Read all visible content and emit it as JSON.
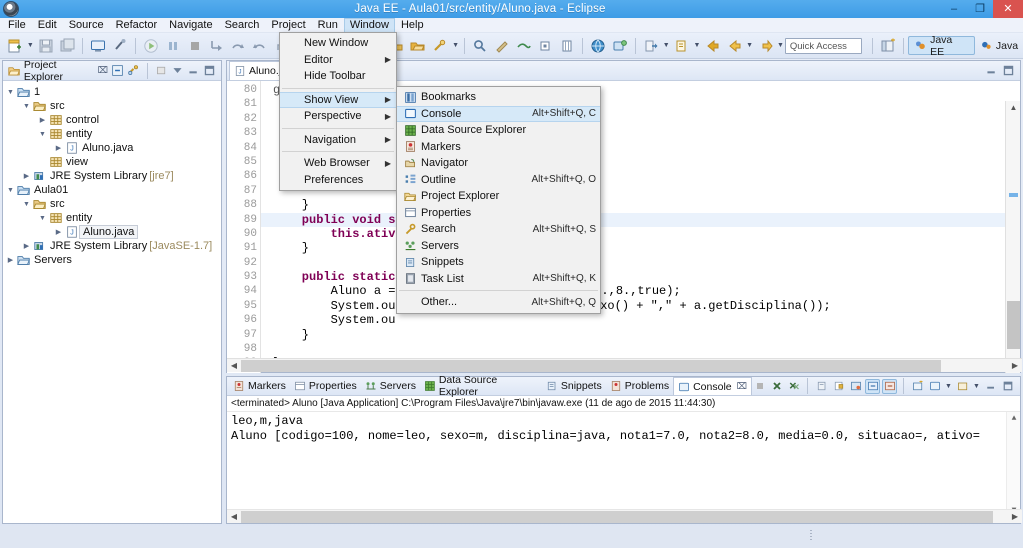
{
  "window": {
    "title": "Java EE - Aula01/src/entity/Aluno.java - Eclipse",
    "minimize_label": "–",
    "restore_label": "❐",
    "close_label": "✕"
  },
  "menubar": {
    "items": [
      {
        "label": "File",
        "active": false
      },
      {
        "label": "Edit",
        "active": false
      },
      {
        "label": "Source",
        "active": false
      },
      {
        "label": "Refactor",
        "active": false
      },
      {
        "label": "Navigate",
        "active": false
      },
      {
        "label": "Search",
        "active": false
      },
      {
        "label": "Project",
        "active": false
      },
      {
        "label": "Run",
        "active": false
      },
      {
        "label": "Window",
        "active": true
      },
      {
        "label": "Help",
        "active": false
      }
    ]
  },
  "toolbar": {
    "quick_access_placeholder": "Quick Access",
    "perspectives": [
      {
        "label": "Java EE",
        "selected": true
      },
      {
        "label": "Java",
        "selected": false
      }
    ]
  },
  "window_menu": {
    "items": [
      {
        "label": "New Window",
        "submenu": false,
        "highlighted": false
      },
      {
        "label": "Editor",
        "submenu": true,
        "highlighted": false
      },
      {
        "label": "Hide Toolbar",
        "submenu": false,
        "highlighted": false
      },
      {
        "separator": true
      },
      {
        "label": "Show View",
        "submenu": true,
        "highlighted": true
      },
      {
        "label": "Perspective",
        "submenu": true,
        "highlighted": false
      },
      {
        "separator": true
      },
      {
        "label": "Navigation",
        "submenu": true,
        "highlighted": false
      },
      {
        "separator": true
      },
      {
        "label": "Web Browser",
        "submenu": true,
        "highlighted": false
      },
      {
        "label": "Preferences",
        "submenu": false,
        "highlighted": false
      }
    ]
  },
  "show_view_menu": {
    "items": [
      {
        "label": "Bookmarks",
        "accel": "",
        "icon": "bookmarks-icon",
        "highlighted": false
      },
      {
        "label": "Console",
        "accel": "Alt+Shift+Q, C",
        "icon": "console-icon",
        "highlighted": true
      },
      {
        "label": "Data Source Explorer",
        "accel": "",
        "icon": "data-source-explorer-icon",
        "highlighted": false
      },
      {
        "label": "Markers",
        "accel": "",
        "icon": "markers-icon",
        "highlighted": false
      },
      {
        "label": "Navigator",
        "accel": "",
        "icon": "navigator-icon",
        "highlighted": false
      },
      {
        "label": "Outline",
        "accel": "Alt+Shift+Q, O",
        "icon": "outline-icon",
        "highlighted": false
      },
      {
        "label": "Project Explorer",
        "accel": "",
        "icon": "project-explorer-icon",
        "highlighted": false
      },
      {
        "label": "Properties",
        "accel": "",
        "icon": "properties-icon",
        "highlighted": false
      },
      {
        "label": "Search",
        "accel": "Alt+Shift+Q, S",
        "icon": "search-icon",
        "highlighted": false
      },
      {
        "label": "Servers",
        "accel": "",
        "icon": "servers-icon",
        "highlighted": false
      },
      {
        "label": "Snippets",
        "accel": "",
        "icon": "snippets-icon",
        "highlighted": false
      },
      {
        "label": "Task List",
        "accel": "Alt+Shift+Q, K",
        "icon": "task-list-icon",
        "highlighted": false
      },
      {
        "separator": true
      },
      {
        "label": "Other...",
        "accel": "Alt+Shift+Q, Q",
        "icon": "",
        "highlighted": false
      }
    ]
  },
  "explorer": {
    "tab_label": "Project Explorer",
    "close_glyph": "⌧",
    "tree": [
      {
        "depth": 0,
        "twist": "open",
        "icon": "project-icon",
        "label": "1",
        "dim": "",
        "selected": false
      },
      {
        "depth": 1,
        "twist": "open",
        "icon": "folder-icon",
        "label": "src",
        "dim": "",
        "selected": false
      },
      {
        "depth": 2,
        "twist": "closed",
        "icon": "package-icon",
        "label": "control",
        "dim": "",
        "selected": false
      },
      {
        "depth": 2,
        "twist": "open",
        "icon": "package-icon",
        "label": "entity",
        "dim": "",
        "selected": false
      },
      {
        "depth": 3,
        "twist": "closed",
        "icon": "java-file-icon",
        "label": "Aluno.java",
        "dim": "",
        "selected": false
      },
      {
        "depth": 2,
        "twist": "none",
        "icon": "package-icon",
        "label": "view",
        "dim": "",
        "selected": false
      },
      {
        "depth": 1,
        "twist": "closed",
        "icon": "library-icon",
        "label": "JRE System Library",
        "dim": "[jre7]",
        "selected": false
      },
      {
        "depth": 0,
        "twist": "open",
        "icon": "project-icon",
        "label": "Aula01",
        "dim": "",
        "selected": false
      },
      {
        "depth": 1,
        "twist": "open",
        "icon": "folder-icon",
        "label": "src",
        "dim": "",
        "selected": false
      },
      {
        "depth": 2,
        "twist": "open",
        "icon": "package-icon",
        "label": "entity",
        "dim": "",
        "selected": false
      },
      {
        "depth": 3,
        "twist": "closed",
        "icon": "java-file-icon",
        "label": "Aluno.java",
        "dim": "",
        "selected": true
      },
      {
        "depth": 1,
        "twist": "closed",
        "icon": "library-icon",
        "label": "JRE System Library",
        "dim": "[JavaSE-1.7]",
        "selected": false
      },
      {
        "depth": 0,
        "twist": "closed",
        "icon": "folder-icon",
        "label": "Servers",
        "dim": "",
        "selected": false
      }
    ]
  },
  "editor": {
    "tab_label": "Aluno.jav",
    "first_line": 80,
    "highlight_line": 89,
    "lines": [
      {
        "n": 80,
        "fold": true,
        "text": "",
        "highlighted": false
      },
      {
        "n": 81,
        "fold": false,
        "text": "",
        "highlighted": false
      },
      {
        "n": 82,
        "fold": false,
        "text": "",
        "highlighted": false
      },
      {
        "n": 83,
        "fold": true,
        "text": "",
        "highlighted": false
      },
      {
        "n": 84,
        "fold": false,
        "text": "",
        "highlighted": false
      },
      {
        "n": 85,
        "fold": false,
        "text": "",
        "highlighted": false
      },
      {
        "n": 86,
        "fold": true,
        "text": "",
        "highlighted": false
      },
      {
        "n": 87,
        "fold": false,
        "text": "",
        "highlighted": false
      },
      {
        "n": 88,
        "fold": false,
        "text": "    }",
        "highlighted": false
      },
      {
        "n": 89,
        "fold": true,
        "text": "    public void s",
        "highlighted": true
      },
      {
        "n": 90,
        "fold": false,
        "text": "        this.ativ",
        "highlighted": false
      },
      {
        "n": 91,
        "fold": false,
        "text": "    }",
        "highlighted": false
      },
      {
        "n": 92,
        "fold": false,
        "text": "",
        "highlighted": false
      },
      {
        "n": 93,
        "fold": true,
        "text": "    public static",
        "highlighted": false
      },
      {
        "n": 94,
        "fold": false,
        "text": "        Aluno a =",
        "highlighted": false
      },
      {
        "n": 95,
        "fold": false,
        "text": "        System.ou",
        "highlighted": false
      },
      {
        "n": 96,
        "fold": false,
        "text": "        System.ou",
        "highlighted": false
      },
      {
        "n": 97,
        "fold": false,
        "text": "    }",
        "highlighted": false
      },
      {
        "n": 98,
        "fold": false,
        "text": "",
        "highlighted": false
      },
      {
        "n": 99,
        "fold": false,
        "text": "}",
        "highlighted": false
      }
    ],
    "visible_code_fragments": {
      "line_80_tail": "getSituacao() {",
      "line_83_tail": "{",
      "line_94_tail": "va\",7.,8.,true);",
      "line_95_tail": "+ a.getSexo() + \",\" + a.getDisciplina());"
    }
  },
  "console": {
    "tabs": [
      {
        "label": "Markers",
        "icon": "markers-icon",
        "active": false
      },
      {
        "label": "Properties",
        "icon": "properties-icon",
        "active": false
      },
      {
        "label": "Servers",
        "icon": "servers-icon",
        "active": false
      },
      {
        "label": "Data Source Explorer",
        "icon": "data-source-explorer-icon",
        "active": false
      },
      {
        "label": "Snippets",
        "icon": "snippets-icon",
        "active": false
      },
      {
        "label": "Problems",
        "icon": "problems-icon",
        "active": false
      },
      {
        "label": "Console",
        "icon": "console-icon",
        "active": true
      }
    ],
    "close_glyph": "⌧",
    "header": "<terminated> Aluno [Java Application] C:\\Program Files\\Java\\jre7\\bin\\javaw.exe (11 de ago de 2015 11:44:30)",
    "output": [
      "leo,m,java",
      "Aluno [codigo=100, nome=leo, sexo=m, disciplina=java, nota1=7.0, nota2=8.0, media=0.0, situacao=, ativo="
    ]
  },
  "colors": {
    "title_bar": "#4ba3e8",
    "close_button": "#d9534f",
    "menu_highlight": "#d6e9f8",
    "selection_blue": "#cfe4f7",
    "keyword": "#7f0055",
    "string": "#2a00ff",
    "field": "#0000c0"
  }
}
